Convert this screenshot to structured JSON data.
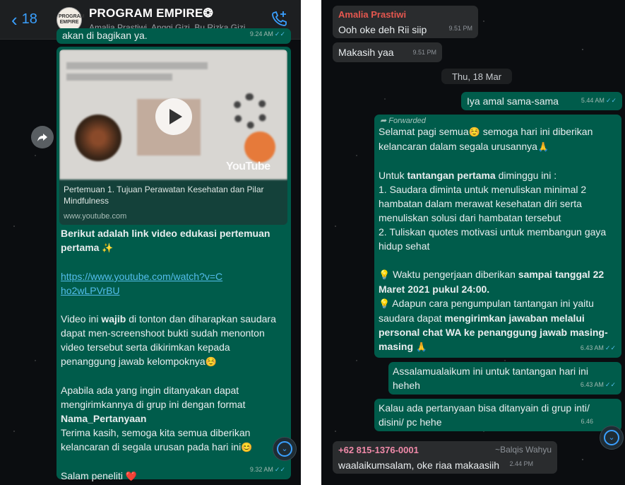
{
  "left": {
    "header": {
      "back_count": "18",
      "group_title": "PROGRAM EMPIRE",
      "group_title_suffix": "❂",
      "members": "Amalia Prastiwi, Anggi Gizi, Bu Rizka Gizi, ...",
      "avatar_text": "PROGRAM EMPIRE"
    },
    "top_bubble": {
      "text": "akan di bagikan ya.",
      "time": "9.24 AM"
    },
    "main_bubble": {
      "preview_title": "Pertemuan 1. Tujuan Perawatan Kesehatan dan Pilar Mindfulness",
      "preview_domain": "www.youtube.com",
      "thumbnail_brand": "YouTube",
      "p1": "Berikut adalah link video edukasi pertemuan pertama",
      "p1_emoji": "✨",
      "link": "https://www.youtube.com/watch?v=Cho2wLPVrBU",
      "p2_a": "Video ini ",
      "p2_bold": "wajib",
      "p2_b": " di tonton dan diharapkan saudara dapat men-screenshoot bukti sudah menonton video tersebut serta dikirimkan kepada penanggung jawab kelompoknya",
      "p2_emoji": "☺️",
      "p3_a": "Apabila ada yang ingin ditanyakan dapat mengirimkannya di grup ini dengan format ",
      "p3_bold": "Nama_Pertanyaan",
      "p3_b": "Terima kasih, semoga kita semua diberikan kelancaran di segala urusan pada hari ini",
      "p3_emoji": "😊",
      "p4": "Salam peneliti",
      "p4_emoji": "❤️",
      "time": "9.32 AM"
    }
  },
  "right": {
    "msg1": {
      "sender": "Amalia Prastiwi",
      "text": "Ooh oke deh Rii siip",
      "time": "9.51 PM"
    },
    "msg2": {
      "text": "Makasih yaa",
      "time": "9.51 PM"
    },
    "date_chip": "Thu, 18 Mar",
    "msg3": {
      "text": "Iya amal sama-sama",
      "time": "5.44 AM"
    },
    "msg4": {
      "forwarded_label": "Forwarded",
      "l1": "Selamat pagi semua",
      "l1_emoji": "☺️",
      "l1_b": " semoga hari ini diberikan kelancaran dalam segala urusannya",
      "l1_emoji2": "🙏",
      "l2_a": "Untuk ",
      "l2_bold": "tantangan pertama",
      "l2_b": " diminggu ini :",
      "l3": "1. Saudara diminta untuk menuliskan minimal 2 hambatan dalam merawat kesehatan diri serta menuliskan solusi dari hambatan tersebut",
      "l4": "2. Tuliskan quotes motivasi untuk membangun gaya hidup sehat",
      "l5_emoji": "💡",
      "l5_a": " Waktu pengerjaan diberikan ",
      "l5_bold": "sampai tanggal 22 Maret 2021 pukul 24:00.",
      "l6_emoji": "💡",
      "l6_a": " Adapun cara pengumpulan tantangan ini yaitu saudara dapat ",
      "l6_bold": "mengirimkan jawaban melalui personal chat WA ke penanggung jawab masing-masing",
      "l6_emoji2": "🙏",
      "time": "6.43 AM"
    },
    "msg5": {
      "text": "Assalamualaikum ini untuk tantangan hari ini heheh",
      "time": "6.43 AM"
    },
    "msg6": {
      "text": "Kalau ada pertanyaan bisa ditanyain di grup inti/ disini/ pc hehe",
      "time": "6.46"
    },
    "msg7": {
      "sender": "+62 815-1376-0001",
      "sender_alias": "~Balqis Wahyu",
      "text": "waalaikumsalam, oke riaa makaasiih",
      "time": "2.44 PM"
    }
  },
  "colors": {
    "outgoing": "#005c4b",
    "incoming": "#2a2c2e",
    "accent": "#3aa0ff",
    "sender_amalia": "#e5574f",
    "sender_balqis": "#f08aa9"
  },
  "icons": [
    "back-chevron-icon",
    "call-add-icon",
    "forward-icon",
    "play-icon",
    "scroll-down-icon",
    "double-check-icon",
    "lightbulb-icon",
    "praying-hands-icon"
  ]
}
